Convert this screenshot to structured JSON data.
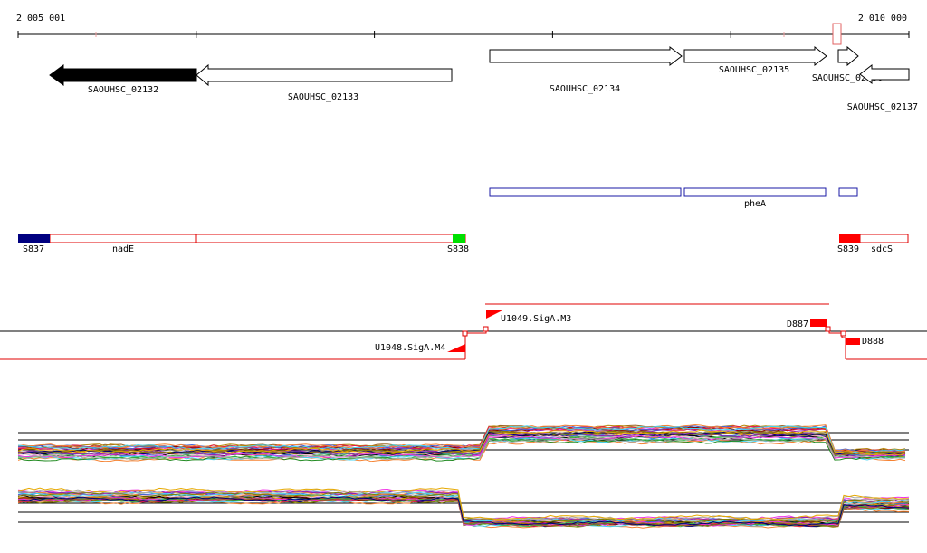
{
  "ruler": {
    "start_label": "2 005 001",
    "end_label": "2 010 000"
  },
  "genes": [
    {
      "id": "SAOUHSC_02132",
      "label": "SAOUHSC_02132",
      "strand": "-",
      "selected": true
    },
    {
      "id": "SAOUHSC_02133",
      "label": "SAOUHSC_02133",
      "strand": "-",
      "selected": false
    },
    {
      "id": "SAOUHSC_02134",
      "label": "SAOUHSC_02134",
      "strand": "+",
      "selected": false
    },
    {
      "id": "SAOUHSC_02135",
      "label": "SAOUHSC_02135",
      "strand": "+",
      "selected": false
    },
    {
      "id": "SAOUHSC_02136",
      "label": "SAOUHSC_02136",
      "strand": "+",
      "selected": false
    },
    {
      "id": "SAOUHSC_02137",
      "label": "SAOUHSC_02137",
      "strand": "-",
      "selected": false
    }
  ],
  "operons": [
    {
      "label": "pheA",
      "color": "#1a1aa6"
    }
  ],
  "regulons": {
    "labels": {
      "s837": "S837",
      "nade": "nadE",
      "s838": "S838",
      "s839": "S839",
      "sdcs": "sdcS"
    },
    "colors": {
      "outline": "#e00000",
      "s837": "#000080",
      "s838": "#00e000",
      "s839": "#ff0000"
    }
  },
  "transcripts": {
    "labels": {
      "u1048": "U1048.SigA.M4",
      "u1049": "U1049.SigA.M3",
      "d887": "D887",
      "d888": "D888"
    },
    "color": "#ff0000"
  },
  "expression": {
    "colors": [
      "#e6194b",
      "#3cb44b",
      "#4363d8",
      "#f58231",
      "#911eb4",
      "#42d4f4",
      "#f032e6",
      "#9a6324",
      "#808000",
      "#000075",
      "#a9a9a9",
      "#e6a800",
      "#800000",
      "#469990",
      "#000000",
      "#fabed4",
      "#228b22",
      "#b8860b"
    ]
  }
}
